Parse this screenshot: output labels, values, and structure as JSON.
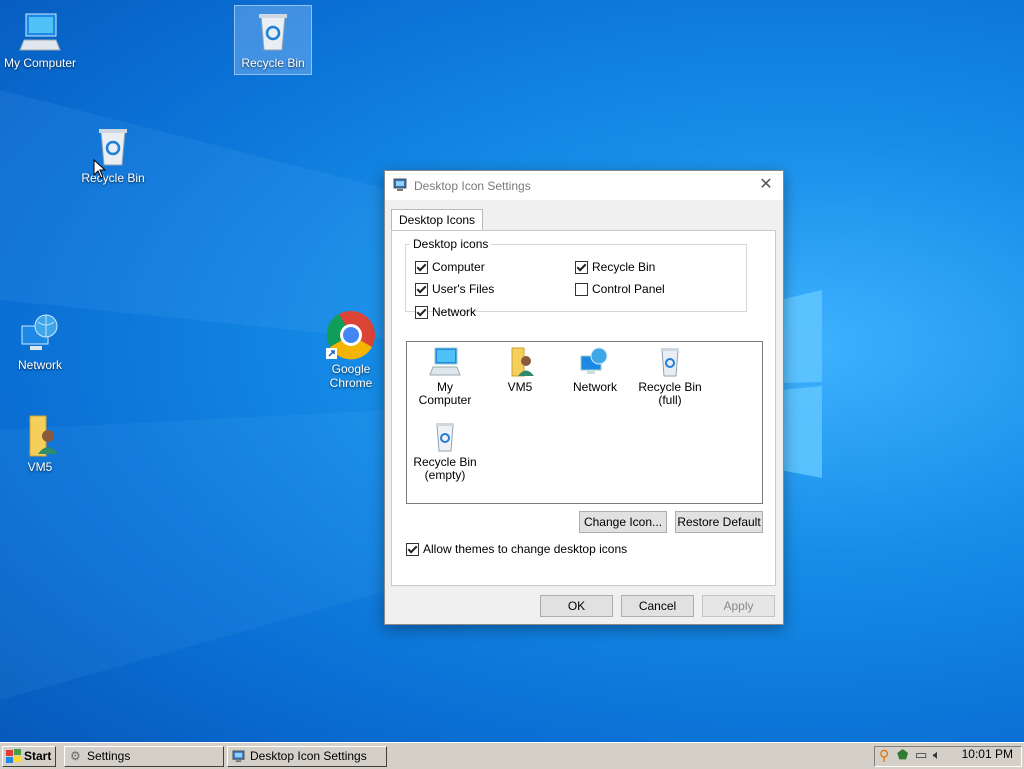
{
  "desktop": {
    "icons": [
      {
        "label": "My Computer"
      },
      {
        "label": "Recycle Bin"
      },
      {
        "label": "Recycle Bin"
      },
      {
        "label": "Network"
      },
      {
        "label": "Google\nChrome"
      },
      {
        "label": "VM5"
      }
    ]
  },
  "dialog": {
    "title": "Desktop Icon Settings",
    "close_glyph": "✕",
    "tab_label": "Desktop Icons",
    "group_label": "Desktop icons",
    "checkboxes": [
      {
        "label": "Computer",
        "checked": true
      },
      {
        "label": "User's Files",
        "checked": true
      },
      {
        "label": "Network",
        "checked": true
      },
      {
        "label": "Recycle Bin",
        "checked": true
      },
      {
        "label": "Control Panel",
        "checked": false
      }
    ],
    "icon_list": [
      {
        "label": "My Computer"
      },
      {
        "label": "VM5"
      },
      {
        "label": "Network"
      },
      {
        "label": "Recycle Bin\n(full)"
      },
      {
        "label": "Recycle Bin\n(empty)"
      }
    ],
    "change_icon_label": "Change Icon...",
    "restore_default_label": "Restore Default",
    "allow_themes": {
      "label": "Allow themes to change desktop icons",
      "checked": true
    },
    "ok_label": "OK",
    "cancel_label": "Cancel",
    "apply_label": "Apply"
  },
  "taskbar": {
    "start_label": "Start",
    "items": [
      {
        "label": "Settings"
      },
      {
        "label": "Desktop Icon Settings"
      }
    ],
    "clock": "10:01 PM"
  },
  "colors": {
    "desktop_blue": "#0a6fd4",
    "taskbar_gray": "#d4d0c8",
    "dialog_bg": "#f0f0f0"
  }
}
